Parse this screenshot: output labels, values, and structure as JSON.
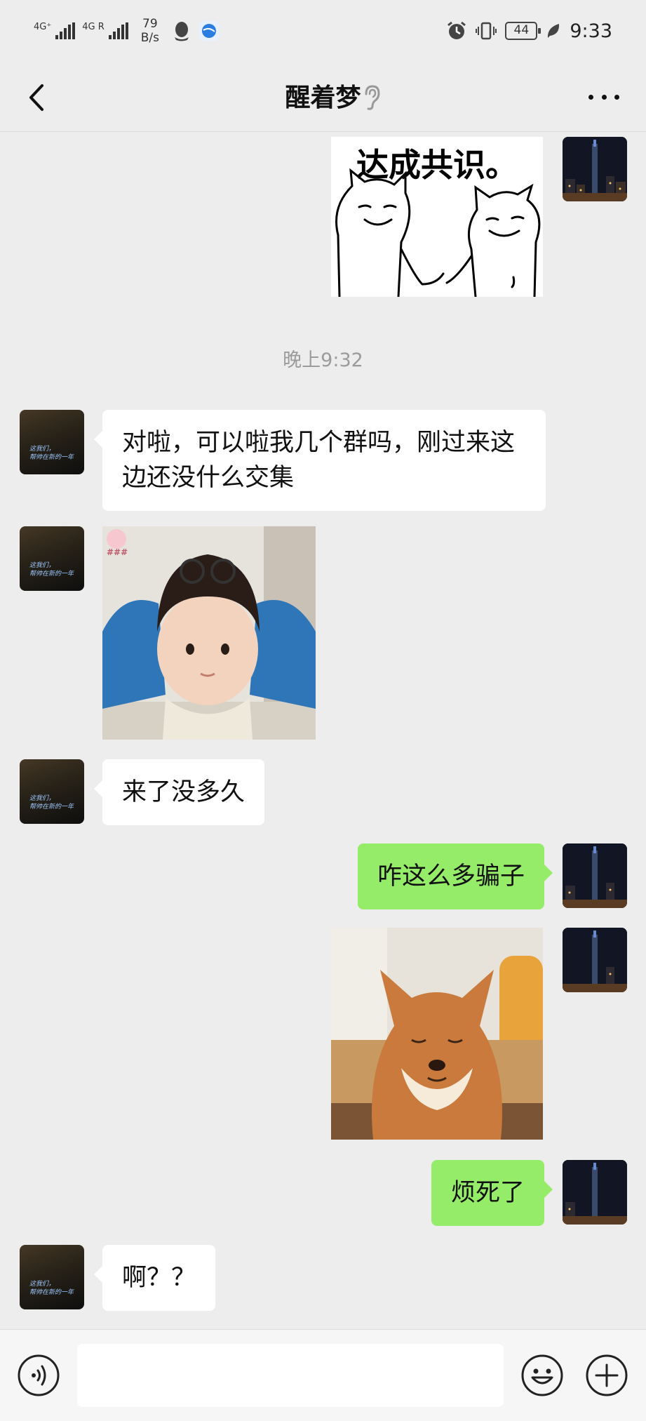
{
  "status_bar": {
    "signal1_label": "4G⁺",
    "signal2_label": "4G R",
    "net_speed_value": "79",
    "net_speed_unit": "B/s",
    "battery_level": "44",
    "time": "9:33",
    "icons": [
      "qq-icon",
      "browser-icon",
      "alarm-icon",
      "vibrate-icon",
      "battery-icon",
      "leaf-icon"
    ]
  },
  "header": {
    "title": "醒着梦",
    "icons": [
      "back-icon",
      "ear-icon",
      "more-icon"
    ]
  },
  "chat": {
    "messages": [
      {
        "sender": "self",
        "type": "sticker",
        "caption": "达成共识。"
      },
      {
        "sender": "system",
        "type": "time",
        "text": "晚上9:32"
      },
      {
        "sender": "other",
        "type": "text",
        "text": "对啦，可以啦我几个群吗，刚过来这边还没什么交集"
      },
      {
        "sender": "other",
        "type": "sticker",
        "badge": "###"
      },
      {
        "sender": "other",
        "type": "text",
        "text": "来了没多久"
      },
      {
        "sender": "self",
        "type": "text",
        "text": "咋这么多骗子"
      },
      {
        "sender": "self",
        "type": "sticker"
      },
      {
        "sender": "self",
        "type": "text",
        "text": "烦死了"
      },
      {
        "sender": "other",
        "type": "text",
        "text": "啊？？"
      }
    ],
    "other_avatar_text": [
      "这我们，",
      "帮帅在新的一年"
    ]
  },
  "input_bar": {
    "placeholder": "",
    "icons": [
      "voice-icon",
      "emoji-icon",
      "plus-icon"
    ]
  },
  "colors": {
    "background": "#ededed",
    "bubble_self": "#95ec69",
    "bubble_other": "#ffffff",
    "timestamp": "#9b9b9b"
  }
}
